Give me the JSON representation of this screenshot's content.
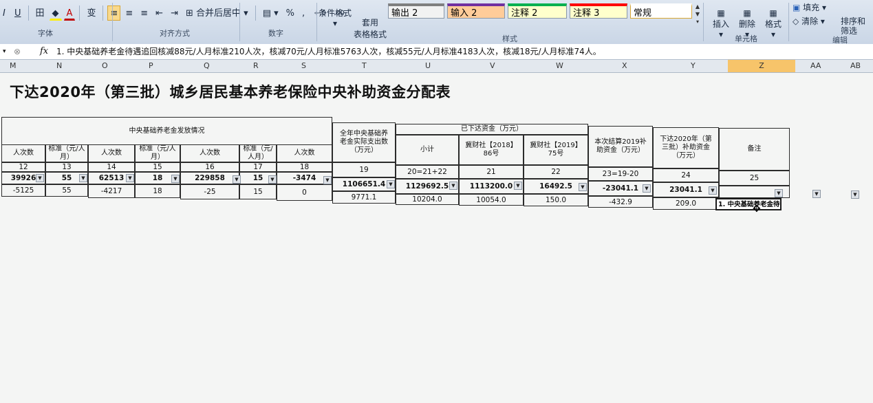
{
  "ribbon": {
    "font_tools": [
      "I",
      "U",
      "田",
      "A",
      "A",
      "变"
    ],
    "merge_label": "合并后居中",
    "number_tools": [
      "%",
      ",",
      "+.0",
      ".00"
    ],
    "conditional_format": "条件格式",
    "format_as_table": "套用\n表格格式",
    "styles": [
      {
        "label": "输出 2",
        "bg": "#f2f2f2",
        "bar": "#7f7f7f"
      },
      {
        "label": "输入 2",
        "bg": "#ffcc99",
        "bar": "#7030a0"
      },
      {
        "label": "注释 2",
        "bg": "#ffffcc",
        "bar": "#00b050"
      },
      {
        "label": "注释 3",
        "bg": "#ffffcc",
        "bar": "#ff0000"
      },
      {
        "label": "常规",
        "bg": "#ffffff",
        "bar": "#ffffff"
      }
    ],
    "cell_buttons": [
      "插入",
      "删除",
      "格式"
    ],
    "fill_label": "填充",
    "clear_label": "清除",
    "sort_label": "排序和\n筛选",
    "groups": [
      "字体",
      "对齐方式",
      "数字",
      "样式",
      "单元格",
      "编辑"
    ]
  },
  "formula_bar": {
    "fx": "fx",
    "content": "1. 中央基础养老金待遇追回核减88元/人月标准210人次，核减70元/人月标准5763人次，核减55元/人月标准4183人次，核减18元/人月标准74人。"
  },
  "columns": [
    "M",
    "N",
    "O",
    "P",
    "Q",
    "R",
    "S",
    "T",
    "U",
    "V",
    "W",
    "X",
    "Y",
    "Z",
    "AA",
    "AB"
  ],
  "sheet": {
    "title": "下达2020年（第三批）城乡居民基本养老保险中央补助资金分配表",
    "headers": {
      "basic_pension": "中央基础养老金发放情况",
      "person_times": "人次数",
      "std_yuan_month": "标准（元/人月）",
      "annual_actual": "全年中央基础养老金实际支出数（万元）",
      "issued_funds": "已下达资金（万元）",
      "subtotal": "小计",
      "doc_2018": "冀财社【2018】86号",
      "doc_2019": "冀财社【2019】75号",
      "settlement_2019": "本次结算2019补助资金（万元）",
      "issue_2020": "下达2020年（第三批）补助资金（万元）",
      "remark": "备注"
    },
    "index_row": [
      "12",
      "13",
      "14",
      "15",
      "16",
      "17",
      "18",
      "19",
      "20=21+22",
      "21",
      "22",
      "23=19-20",
      "24",
      "25"
    ],
    "row1": [
      "39926",
      "55",
      "62513",
      "18",
      "229858",
      "15",
      "-3474",
      "1106651.4",
      "1129692.5",
      "1113200.0",
      "16492.5",
      "-23041.1",
      "23041.1",
      ""
    ],
    "row2": [
      "-5125",
      "55",
      "-4217",
      "18",
      "-25",
      "15",
      "0",
      "9771.1",
      "10204.0",
      "10054.0",
      "150.0",
      "-432.9",
      "209.0"
    ],
    "active_cell": "1. 中央基础养老金待"
  }
}
